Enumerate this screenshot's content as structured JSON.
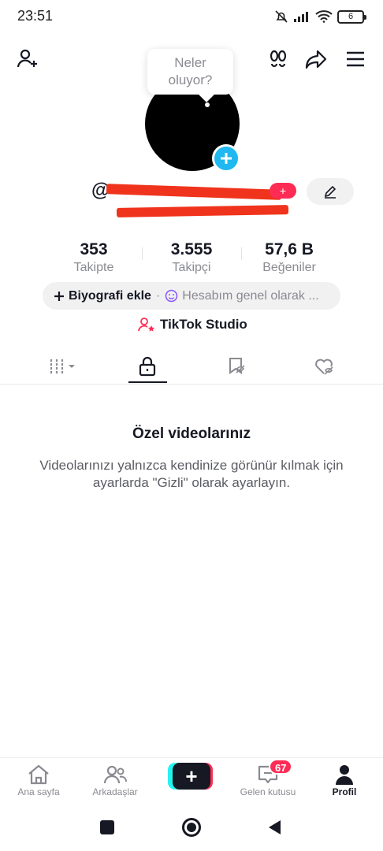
{
  "status_bar": {
    "time": "23:51",
    "battery": "6"
  },
  "tooltip": {
    "text_line1": "Neler",
    "text_line2": "oluyor?"
  },
  "profile": {
    "username": "@",
    "notify_pill": "+"
  },
  "stats": [
    {
      "value": "353",
      "label": "Takipte"
    },
    {
      "value": "3.555",
      "label": "Takipçi"
    },
    {
      "value": "57,6 B",
      "label": "Beğeniler"
    }
  ],
  "bio": {
    "add_label": "Biyografi ekle",
    "separator": "·",
    "status_text": "Hesabım genel olarak ..."
  },
  "studio": {
    "label": "TikTok Studio"
  },
  "empty_state": {
    "title": "Özel videolarınız",
    "text": "Videolarınızı yalnızca kendinize görünür kılmak için ayarlarda \"Gizli\" olarak ayarlayın."
  },
  "bottom_nav": {
    "items": [
      {
        "label": "Ana sayfa"
      },
      {
        "label": "Arkadaşlar"
      },
      {
        "label": "Gelen kutusu"
      },
      {
        "label": "Profil"
      }
    ],
    "create_label": "+",
    "inbox_badge": "67"
  },
  "colors": {
    "accent": "#fe2c55",
    "cyan": "#25f4ee",
    "avatar_add": "#1fb8f0",
    "redaction": "#f0331c"
  }
}
